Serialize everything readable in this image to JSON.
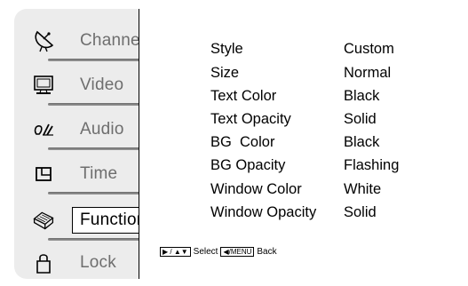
{
  "sidebar": {
    "items": [
      {
        "label": "Channel",
        "icon": "satellite-dish-icon"
      },
      {
        "label": "Video",
        "icon": "monitor-icon"
      },
      {
        "label": "Audio",
        "icon": "audio-icon"
      },
      {
        "label": "Time",
        "icon": "clock-icon"
      },
      {
        "label": "Function",
        "icon": "settings-box-icon",
        "active": true
      },
      {
        "label": "Lock",
        "icon": "padlock-icon"
      }
    ]
  },
  "panel": {
    "rows": [
      {
        "label": "Style",
        "value": "Custom"
      },
      {
        "label": "Size",
        "value": "Normal"
      },
      {
        "label": "Text Color",
        "value": "Black"
      },
      {
        "label": "Text Opacity",
        "value": "Solid"
      },
      {
        "label": "BG  Color",
        "value": "Black"
      },
      {
        "label": "BG Opacity",
        "value": "Flashing"
      },
      {
        "label": "Window Color",
        "value": "White"
      },
      {
        "label": "Window Opacity",
        "value": "Solid"
      }
    ]
  },
  "hint": {
    "nav_keys": "▶ / ▲▼",
    "select_label": "Select",
    "menu_key": "◀/MENU",
    "back_label": "Back"
  },
  "colors": {
    "sidebar_bg": "#ececec",
    "inactive_text": "#6e6e6e",
    "active_text": "#000000"
  }
}
